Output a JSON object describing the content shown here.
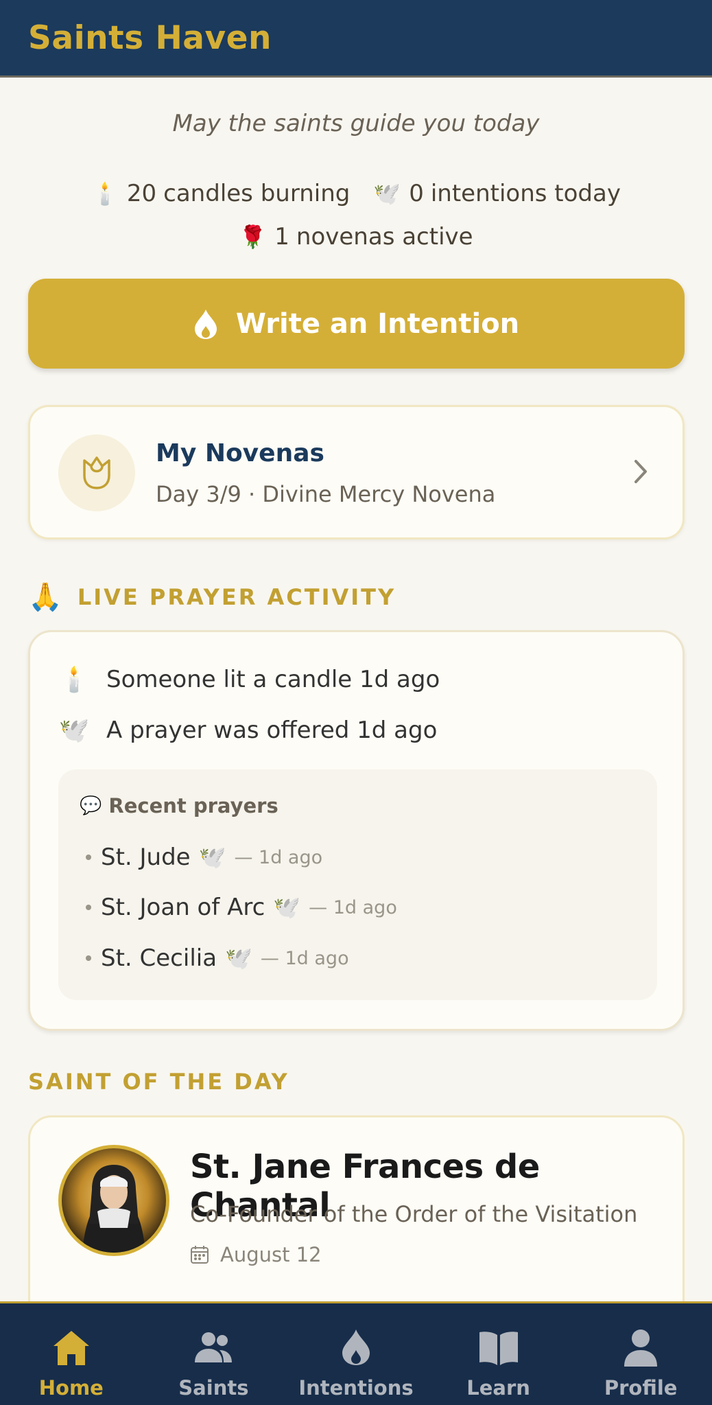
{
  "app": {
    "title": "Saints Haven"
  },
  "tagline": "May the saints guide you today",
  "stats": [
    {
      "icon": "candle-icon",
      "emoji": "🕯️",
      "value": "20",
      "text": "candles burning"
    },
    {
      "icon": "dove-icon",
      "emoji": "🕊️",
      "value": "0",
      "text": "intentions today"
    },
    {
      "icon": "rose-icon",
      "emoji": "🌹",
      "value": "1",
      "text": "novenas active"
    }
  ],
  "write_button": {
    "label": "Write an Intention",
    "icon": "flame-icon"
  },
  "novenas": {
    "title": "My Novenas",
    "subtitle": "Day 3/9 · Divine Mercy Novena",
    "icon": "rose-outline-icon"
  },
  "live_activity": {
    "heading": "LIVE PRAYER ACTIVITY",
    "icon": "praying-hands-icon",
    "emoji": "🙏",
    "lines": [
      {
        "icon": "candle-icon",
        "emoji": "🕯️",
        "text": "Someone lit a candle 1d ago"
      },
      {
        "icon": "dove-icon",
        "emoji": "🕊️",
        "text": "A prayer was offered 1d ago"
      }
    ],
    "recent": {
      "heading": "Recent prayers",
      "icon": "speech-bubble-icon",
      "emoji": "💬",
      "items": [
        {
          "name": "St. Jude",
          "emoji": "🕊️",
          "ago": "— 1d ago"
        },
        {
          "name": "St. Joan of Arc",
          "emoji": "🕊️",
          "ago": "— 1d ago"
        },
        {
          "name": "St. Cecilia",
          "emoji": "🕊️",
          "ago": "— 1d ago"
        }
      ]
    }
  },
  "saint_of_day": {
    "heading": "SAINT OF THE DAY",
    "name": "St. Jane Frances de Chantal",
    "title": "Co-Founder of the Order of the Visitation",
    "date": "August 12",
    "icon": "calendar-icon"
  },
  "nav": [
    {
      "label": "Home",
      "icon": "home-icon",
      "active": true
    },
    {
      "label": "Saints",
      "icon": "people-icon",
      "active": false
    },
    {
      "label": "Intentions",
      "icon": "flame-icon",
      "active": false
    },
    {
      "label": "Learn",
      "icon": "book-icon",
      "active": false
    },
    {
      "label": "Profile",
      "icon": "person-icon",
      "active": false
    }
  ],
  "colors": {
    "navy": "#1b3a5c",
    "gold": "#d4af37",
    "background": "#f8f6f0"
  }
}
